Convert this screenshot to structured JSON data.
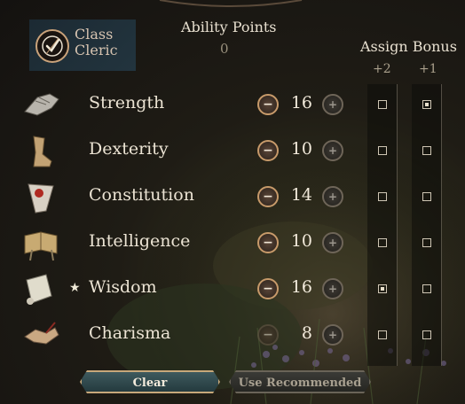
{
  "class_panel": {
    "label": "Class",
    "value": "Cleric"
  },
  "ability_points": {
    "title": "Ability Points",
    "value": "0"
  },
  "assign_bonus": {
    "title": "Assign Bonus",
    "col_plus2": "+2",
    "col_plus1": "+1"
  },
  "abilities": [
    {
      "name": "Strength",
      "value": "16",
      "bonus2": false,
      "bonus1": true,
      "starred": false,
      "icon": "gauntlet-icon"
    },
    {
      "name": "Dexterity",
      "value": "10",
      "bonus2": false,
      "bonus1": false,
      "starred": false,
      "icon": "boot-icon"
    },
    {
      "name": "Constitution",
      "value": "14",
      "bonus2": false,
      "bonus1": false,
      "starred": false,
      "icon": "shield-heart-icon"
    },
    {
      "name": "Intelligence",
      "value": "10",
      "bonus2": false,
      "bonus1": false,
      "starred": false,
      "icon": "book-icon"
    },
    {
      "name": "Wisdom",
      "value": "16",
      "bonus2": true,
      "bonus1": false,
      "starred": true,
      "icon": "scroll-icon"
    },
    {
      "name": "Charisma",
      "value": "8",
      "bonus2": false,
      "bonus1": false,
      "starred": false,
      "icon": "handshake-icon"
    }
  ],
  "star_glyph": "★",
  "minus_glyph": "−",
  "plus_glyph": "+",
  "buttons": {
    "clear": "Clear",
    "recommended": "Use Recommended"
  },
  "colors": {
    "accent_gold": "#c79a6a",
    "clear_button": "#2f4a4e",
    "panel_teal": "#1f2f38"
  }
}
